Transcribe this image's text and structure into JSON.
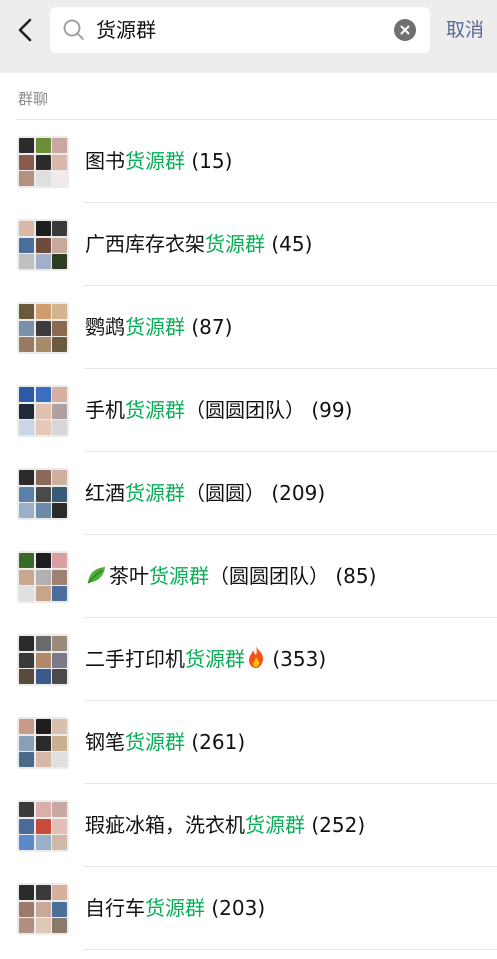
{
  "search": {
    "query": "货源群",
    "cancel_label": "取消"
  },
  "section": {
    "title": "群聊"
  },
  "results": [
    {
      "pre": "图书",
      "hl": "货源群",
      "post": "",
      "count": "(15)",
      "icon_before": "",
      "icon_after": "",
      "avatar": [
        "#2b2b2b",
        "#6b8e3b",
        "#c9a7a0",
        "#8a5a4a",
        "#2c2c2c",
        "#d8b8a8",
        "#b39080",
        "#e0e0e0",
        "#f0eaea"
      ]
    },
    {
      "pre": "广西库存衣架",
      "hl": "货源群",
      "post": "",
      "count": "(45)",
      "icon_before": "",
      "icon_after": "",
      "avatar": [
        "#d9b9a6",
        "#1e1e1e",
        "#3a3a3a",
        "#4a6f9a",
        "#6e4b3a",
        "#c7a99c",
        "#bfbfbf",
        "#9fb0c8",
        "#2e3d22"
      ]
    },
    {
      "pre": "鹦鹉",
      "hl": "货源群",
      "post": "",
      "count": "(87)",
      "icon_before": "",
      "icon_after": "",
      "avatar": [
        "#6a5a3a",
        "#cf9d6f",
        "#d3b48e",
        "#7a8fa8",
        "#3c3c3c",
        "#8a6a50",
        "#9a7a62",
        "#a58b6a",
        "#6b5a3f"
      ]
    },
    {
      "pre": "手机",
      "hl": "货源群",
      "post": "（圆圆团队）",
      "count": "(99)",
      "icon_before": "",
      "icon_after": "",
      "avatar": [
        "#2a5aa8",
        "#3a6fc0",
        "#d8b0a0",
        "#1f2a3a",
        "#e0c0b0",
        "#b0a0a0",
        "#c9d6e6",
        "#e6c8b8",
        "#d7d7d7"
      ]
    },
    {
      "pre": "红酒",
      "hl": "货源群",
      "post": "（圆圆）",
      "count": "(209)",
      "icon_before": "",
      "icon_after": "",
      "avatar": [
        "#2b2b2b",
        "#8a6a5a",
        "#d0b0a0",
        "#5a7fa8",
        "#4a4a4a",
        "#3a5a7a",
        "#9ab0c8",
        "#6a8aa8",
        "#2a2a2a"
      ]
    },
    {
      "pre": "茶叶",
      "hl": "货源群",
      "post": "（圆圆团队）",
      "count": "(85)",
      "icon_before": "leaf",
      "icon_after": "",
      "avatar": [
        "#3a6a2a",
        "#1e1e1e",
        "#d8a0a0",
        "#c8a890",
        "#b0b0b0",
        "#a08070",
        "#e0e0e0",
        "#c7a58b",
        "#4a6f9a"
      ]
    },
    {
      "pre": "二手打印机",
      "hl": "货源群",
      "post": "",
      "count": "(353)",
      "icon_before": "",
      "icon_after": "fire",
      "avatar": [
        "#2b2b2b",
        "#6a6a6a",
        "#9a8a7a",
        "#3a3a3a",
        "#b08a6a",
        "#7a7a8a",
        "#5a4a3a",
        "#3a5a8a",
        "#4a4a4a"
      ]
    },
    {
      "pre": "钢笔",
      "hl": "货源群",
      "post": "",
      "count": "(261)",
      "icon_before": "",
      "icon_after": "",
      "avatar": [
        "#c89a8a",
        "#1e1e1e",
        "#d8c0b0",
        "#8aa0b8",
        "#2b2b2b",
        "#c9b090",
        "#4a6a8a",
        "#d8b8a8",
        "#e0e0e0"
      ]
    },
    {
      "pre": "瑕疵冰箱，洗衣机",
      "hl": "货源群",
      "post": "",
      "count": "(252)",
      "icon_before": "",
      "icon_after": "",
      "avatar": [
        "#3a3a3a",
        "#d8b0a8",
        "#c8a8a0",
        "#4a6a9a",
        "#c84a3a",
        "#e0c0b8",
        "#5a8ac8",
        "#9ab0c8",
        "#d0b8a8"
      ]
    },
    {
      "pre": "自行车",
      "hl": "货源群",
      "post": "",
      "count": "(203)",
      "icon_before": "",
      "icon_after": "",
      "avatar": [
        "#2b2b2b",
        "#3a3a3a",
        "#d8b0a0",
        "#9a7a6a",
        "#c9a89a",
        "#4a6f9a",
        "#b09080",
        "#e0c8b8",
        "#8a7a6a"
      ]
    }
  ]
}
